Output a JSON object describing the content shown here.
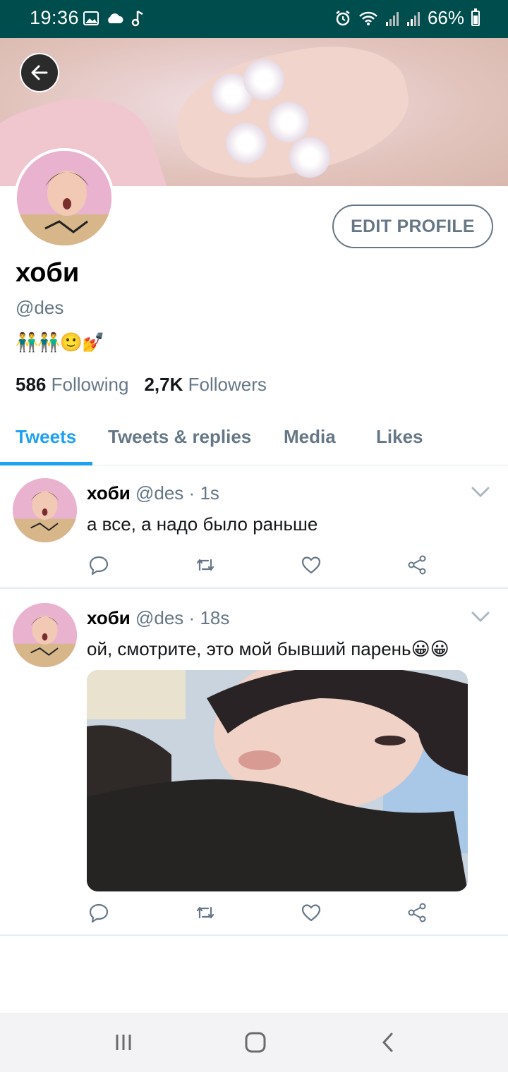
{
  "status_bar": {
    "time": "19:36",
    "battery": "66%"
  },
  "profile": {
    "display_name": "хоби",
    "handle": "@des",
    "bio": "👬👬🙂💅",
    "edit_button": "EDIT PROFILE",
    "following_count": "586",
    "following_label": "Following",
    "followers_count": "2,7K",
    "followers_label": "Followers"
  },
  "tabs": [
    {
      "label": "Tweets",
      "active": true
    },
    {
      "label": "Tweets & replies",
      "active": false
    },
    {
      "label": "Media",
      "active": false
    },
    {
      "label": "Likes",
      "active": false
    }
  ],
  "tweets": [
    {
      "name": "хоби",
      "handle": "@des",
      "time": "1s",
      "text": "а все, а надо было раньше"
    },
    {
      "name": "хоби",
      "handle": "@des",
      "time": "18s",
      "text": "ой, смотрите, это мой бывший парень😀😀"
    }
  ],
  "colors": {
    "accent": "#1da1f2",
    "secondary_text": "#657786",
    "status_bar": "#004d4d"
  },
  "icons": {
    "back": "arrow-left-icon",
    "reply": "reply-icon",
    "retweet": "retweet-icon",
    "like": "heart-icon",
    "share": "share-icon",
    "caret": "chevron-down-icon"
  }
}
